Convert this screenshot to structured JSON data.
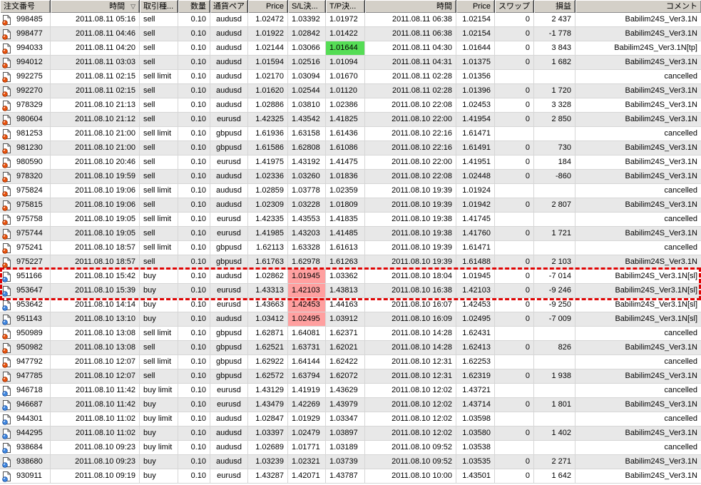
{
  "colors": {
    "header_bg": "#d4d0c8",
    "row_alt": "#e8e8e8",
    "grid": "#d6d6d6",
    "tp_highlight": "#55dd55",
    "sl_highlight": "#ffa0a0",
    "selection": "#e00505",
    "sell_ball": "#e8520e",
    "sell_ball_stroke": "#9a3000",
    "buy_ball": "#3f87e0",
    "buy_ball_stroke": "#1c4f9c"
  },
  "table": {
    "sort_icon": "▽",
    "columns": [
      {
        "id": "order",
        "label": "注文番号",
        "align": "left"
      },
      {
        "id": "open_time",
        "label": "時間",
        "align": "right"
      },
      {
        "id": "type",
        "label": "取引種...",
        "align": "left"
      },
      {
        "id": "volume",
        "label": "数量",
        "align": "right"
      },
      {
        "id": "pair",
        "label": "通貨ペア",
        "align": "center"
      },
      {
        "id": "open_price",
        "label": "Price",
        "align": "right"
      },
      {
        "id": "sl",
        "label": "S/L決...",
        "align": "left"
      },
      {
        "id": "tp",
        "label": "T/P決...",
        "align": "left"
      },
      {
        "id": "close_time",
        "label": "時間",
        "align": "right"
      },
      {
        "id": "close_price",
        "label": "Price",
        "align": "right"
      },
      {
        "id": "swap",
        "label": "スワップ",
        "align": "right"
      },
      {
        "id": "profit",
        "label": "損益",
        "align": "right"
      },
      {
        "id": "comment",
        "label": "コメント",
        "align": "right"
      }
    ],
    "rows": [
      {
        "order": "998485",
        "dir": "sell",
        "open_time": "2011.08.11 05:16",
        "type": "sell",
        "volume": "0.10",
        "pair": "audusd",
        "open_price": "1.02472",
        "sl": "1.03392",
        "tp": "1.01972",
        "close_time": "2011.08.11 06:38",
        "close_price": "1.02154",
        "swap": "0",
        "profit": "2 437",
        "comment": "Babilim24S_Ver3.1N"
      },
      {
        "order": "998477",
        "dir": "sell",
        "open_time": "2011.08.11 04:46",
        "type": "sell",
        "volume": "0.10",
        "pair": "audusd",
        "open_price": "1.01922",
        "sl": "1.02842",
        "tp": "1.01422",
        "close_time": "2011.08.11 06:38",
        "close_price": "1.02154",
        "swap": "0",
        "profit": "-1 778",
        "comment": "Babilim24S_Ver3.1N"
      },
      {
        "order": "994033",
        "dir": "sell",
        "open_time": "2011.08.11 04:20",
        "type": "sell",
        "volume": "0.10",
        "pair": "audusd",
        "open_price": "1.02144",
        "sl": "1.03066",
        "tp": "1.01644",
        "tp_hl": true,
        "close_time": "2011.08.11 04:30",
        "close_price": "1.01644",
        "swap": "0",
        "profit": "3 843",
        "comment": "Babilim24S_Ver3.1N[tp]"
      },
      {
        "order": "994012",
        "dir": "sell",
        "open_time": "2011.08.11 03:03",
        "type": "sell",
        "volume": "0.10",
        "pair": "audusd",
        "open_price": "1.01594",
        "sl": "1.02516",
        "tp": "1.01094",
        "close_time": "2011.08.11 04:31",
        "close_price": "1.01375",
        "swap": "0",
        "profit": "1 682",
        "comment": "Babilim24S_Ver3.1N"
      },
      {
        "order": "992275",
        "dir": "sell",
        "open_time": "2011.08.11 02:15",
        "type": "sell limit",
        "volume": "0.10",
        "pair": "audusd",
        "open_price": "1.02170",
        "sl": "1.03094",
        "tp": "1.01670",
        "close_time": "2011.08.11 02:28",
        "close_price": "1.01356",
        "swap": "",
        "profit": "",
        "comment": "cancelled"
      },
      {
        "order": "992270",
        "dir": "sell",
        "open_time": "2011.08.11 02:15",
        "type": "sell",
        "volume": "0.10",
        "pair": "audusd",
        "open_price": "1.01620",
        "sl": "1.02544",
        "tp": "1.01120",
        "close_time": "2011.08.11 02:28",
        "close_price": "1.01396",
        "swap": "0",
        "profit": "1 720",
        "comment": "Babilim24S_Ver3.1N"
      },
      {
        "order": "978329",
        "dir": "sell",
        "open_time": "2011.08.10 21:13",
        "type": "sell",
        "volume": "0.10",
        "pair": "audusd",
        "open_price": "1.02886",
        "sl": "1.03810",
        "tp": "1.02386",
        "close_time": "2011.08.10 22:08",
        "close_price": "1.02453",
        "swap": "0",
        "profit": "3 328",
        "comment": "Babilim24S_Ver3.1N"
      },
      {
        "order": "980604",
        "dir": "sell",
        "open_time": "2011.08.10 21:12",
        "type": "sell",
        "volume": "0.10",
        "pair": "eurusd",
        "open_price": "1.42325",
        "sl": "1.43542",
        "tp": "1.41825",
        "close_time": "2011.08.10 22:00",
        "close_price": "1.41954",
        "swap": "0",
        "profit": "2 850",
        "comment": "Babilim24S_Ver3.1N"
      },
      {
        "order": "981253",
        "dir": "sell",
        "open_time": "2011.08.10 21:00",
        "type": "sell limit",
        "volume": "0.10",
        "pair": "gbpusd",
        "open_price": "1.61936",
        "sl": "1.63158",
        "tp": "1.61436",
        "close_time": "2011.08.10 22:16",
        "close_price": "1.61471",
        "swap": "",
        "profit": "",
        "comment": "cancelled"
      },
      {
        "order": "981230",
        "dir": "sell",
        "open_time": "2011.08.10 21:00",
        "type": "sell",
        "volume": "0.10",
        "pair": "gbpusd",
        "open_price": "1.61586",
        "sl": "1.62808",
        "tp": "1.61086",
        "close_time": "2011.08.10 22:16",
        "close_price": "1.61491",
        "swap": "0",
        "profit": "730",
        "comment": "Babilim24S_Ver3.1N"
      },
      {
        "order": "980590",
        "dir": "sell",
        "open_time": "2011.08.10 20:46",
        "type": "sell",
        "volume": "0.10",
        "pair": "eurusd",
        "open_price": "1.41975",
        "sl": "1.43192",
        "tp": "1.41475",
        "close_time": "2011.08.10 22:00",
        "close_price": "1.41951",
        "swap": "0",
        "profit": "184",
        "comment": "Babilim24S_Ver3.1N"
      },
      {
        "order": "978320",
        "dir": "sell",
        "open_time": "2011.08.10 19:59",
        "type": "sell",
        "volume": "0.10",
        "pair": "audusd",
        "open_price": "1.02336",
        "sl": "1.03260",
        "tp": "1.01836",
        "close_time": "2011.08.10 22:08",
        "close_price": "1.02448",
        "swap": "0",
        "profit": "-860",
        "comment": "Babilim24S_Ver3.1N"
      },
      {
        "order": "975824",
        "dir": "sell",
        "open_time": "2011.08.10 19:06",
        "type": "sell limit",
        "volume": "0.10",
        "pair": "audusd",
        "open_price": "1.02859",
        "sl": "1.03778",
        "tp": "1.02359",
        "close_time": "2011.08.10 19:39",
        "close_price": "1.01924",
        "swap": "",
        "profit": "",
        "comment": "cancelled"
      },
      {
        "order": "975815",
        "dir": "sell",
        "open_time": "2011.08.10 19:06",
        "type": "sell",
        "volume": "0.10",
        "pair": "audusd",
        "open_price": "1.02309",
        "sl": "1.03228",
        "tp": "1.01809",
        "close_time": "2011.08.10 19:39",
        "close_price": "1.01942",
        "swap": "0",
        "profit": "2 807",
        "comment": "Babilim24S_Ver3.1N"
      },
      {
        "order": "975758",
        "dir": "sell",
        "open_time": "2011.08.10 19:05",
        "type": "sell limit",
        "volume": "0.10",
        "pair": "eurusd",
        "open_price": "1.42335",
        "sl": "1.43553",
        "tp": "1.41835",
        "close_time": "2011.08.10 19:38",
        "close_price": "1.41745",
        "swap": "",
        "profit": "",
        "comment": "cancelled"
      },
      {
        "order": "975744",
        "dir": "sell",
        "open_time": "2011.08.10 19:05",
        "type": "sell",
        "volume": "0.10",
        "pair": "eurusd",
        "open_price": "1.41985",
        "sl": "1.43203",
        "tp": "1.41485",
        "close_time": "2011.08.10 19:38",
        "close_price": "1.41760",
        "swap": "0",
        "profit": "1 721",
        "comment": "Babilim24S_Ver3.1N"
      },
      {
        "order": "975241",
        "dir": "sell",
        "open_time": "2011.08.10 18:57",
        "type": "sell limit",
        "volume": "0.10",
        "pair": "gbpusd",
        "open_price": "1.62113",
        "sl": "1.63328",
        "tp": "1.61613",
        "close_time": "2011.08.10 19:39",
        "close_price": "1.61471",
        "swap": "",
        "profit": "",
        "comment": "cancelled"
      },
      {
        "order": "975227",
        "dir": "sell",
        "open_time": "2011.08.10 18:57",
        "type": "sell",
        "volume": "0.10",
        "pair": "gbpusd",
        "open_price": "1.61763",
        "sl": "1.62978",
        "tp": "1.61263",
        "close_time": "2011.08.10 19:39",
        "close_price": "1.61488",
        "swap": "0",
        "profit": "2 103",
        "comment": "Babilim24S_Ver3.1N"
      },
      {
        "order": "951166",
        "dir": "buy",
        "selected": true,
        "open_time": "2011.08.10 15:42",
        "type": "buy",
        "volume": "0.10",
        "pair": "audusd",
        "open_price": "1.02862",
        "sl": "1.01945",
        "sl_hl": true,
        "tp": "1.03362",
        "close_time": "2011.08.10 18:04",
        "close_price": "1.01945",
        "swap": "0",
        "profit": "-7 014",
        "comment": "Babilim24S_Ver3.1N[sl]"
      },
      {
        "order": "953647",
        "dir": "buy",
        "selected": true,
        "open_time": "2011.08.10 15:39",
        "type": "buy",
        "volume": "0.10",
        "pair": "eurusd",
        "open_price": "1.43313",
        "sl": "1.42103",
        "sl_hl": true,
        "tp": "1.43813",
        "close_time": "2011.08.10 16:38",
        "close_price": "1.42103",
        "swap": "0",
        "profit": "-9 246",
        "comment": "Babilim24S_Ver3.1N[sl]"
      },
      {
        "order": "953642",
        "dir": "buy",
        "open_time": "2011.08.10 14:14",
        "type": "buy",
        "volume": "0.10",
        "pair": "eurusd",
        "open_price": "1.43663",
        "sl": "1.42453",
        "sl_hl": true,
        "tp": "1.44163",
        "close_time": "2011.08.10 16:07",
        "close_price": "1.42453",
        "swap": "0",
        "profit": "-9 250",
        "comment": "Babilim24S_Ver3.1N[sl]"
      },
      {
        "order": "951143",
        "dir": "buy",
        "open_time": "2011.08.10 13:10",
        "type": "buy",
        "volume": "0.10",
        "pair": "audusd",
        "open_price": "1.03412",
        "sl": "1.02495",
        "sl_hl": true,
        "tp": "1.03912",
        "close_time": "2011.08.10 16:09",
        "close_price": "1.02495",
        "swap": "0",
        "profit": "-7 009",
        "comment": "Babilim24S_Ver3.1N[sl]"
      },
      {
        "order": "950989",
        "dir": "sell",
        "open_time": "2011.08.10 13:08",
        "type": "sell limit",
        "volume": "0.10",
        "pair": "gbpusd",
        "open_price": "1.62871",
        "sl": "1.64081",
        "tp": "1.62371",
        "close_time": "2011.08.10 14:28",
        "close_price": "1.62431",
        "swap": "",
        "profit": "",
        "comment": "cancelled"
      },
      {
        "order": "950982",
        "dir": "sell",
        "open_time": "2011.08.10 13:08",
        "type": "sell",
        "volume": "0.10",
        "pair": "gbpusd",
        "open_price": "1.62521",
        "sl": "1.63731",
        "tp": "1.62021",
        "close_time": "2011.08.10 14:28",
        "close_price": "1.62413",
        "swap": "0",
        "profit": "826",
        "comment": "Babilim24S_Ver3.1N"
      },
      {
        "order": "947792",
        "dir": "sell",
        "open_time": "2011.08.10 12:07",
        "type": "sell limit",
        "volume": "0.10",
        "pair": "gbpusd",
        "open_price": "1.62922",
        "sl": "1.64144",
        "tp": "1.62422",
        "close_time": "2011.08.10 12:31",
        "close_price": "1.62253",
        "swap": "",
        "profit": "",
        "comment": "cancelled"
      },
      {
        "order": "947785",
        "dir": "sell",
        "open_time": "2011.08.10 12:07",
        "type": "sell",
        "volume": "0.10",
        "pair": "gbpusd",
        "open_price": "1.62572",
        "sl": "1.63794",
        "tp": "1.62072",
        "close_time": "2011.08.10 12:31",
        "close_price": "1.62319",
        "swap": "0",
        "profit": "1 938",
        "comment": "Babilim24S_Ver3.1N"
      },
      {
        "order": "946718",
        "dir": "buy",
        "open_time": "2011.08.10 11:42",
        "type": "buy limit",
        "volume": "0.10",
        "pair": "eurusd",
        "open_price": "1.43129",
        "sl": "1.41919",
        "tp": "1.43629",
        "close_time": "2011.08.10 12:02",
        "close_price": "1.43721",
        "swap": "",
        "profit": "",
        "comment": "cancelled"
      },
      {
        "order": "946687",
        "dir": "buy",
        "open_time": "2011.08.10 11:42",
        "type": "buy",
        "volume": "0.10",
        "pair": "eurusd",
        "open_price": "1.43479",
        "sl": "1.42269",
        "tp": "1.43979",
        "close_time": "2011.08.10 12:02",
        "close_price": "1.43714",
        "swap": "0",
        "profit": "1 801",
        "comment": "Babilim24S_Ver3.1N"
      },
      {
        "order": "944301",
        "dir": "buy",
        "open_time": "2011.08.10 11:02",
        "type": "buy limit",
        "volume": "0.10",
        "pair": "audusd",
        "open_price": "1.02847",
        "sl": "1.01929",
        "tp": "1.03347",
        "close_time": "2011.08.10 12:02",
        "close_price": "1.03598",
        "swap": "",
        "profit": "",
        "comment": "cancelled"
      },
      {
        "order": "944295",
        "dir": "buy",
        "open_time": "2011.08.10 11:02",
        "type": "buy",
        "volume": "0.10",
        "pair": "audusd",
        "open_price": "1.03397",
        "sl": "1.02479",
        "tp": "1.03897",
        "close_time": "2011.08.10 12:02",
        "close_price": "1.03580",
        "swap": "0",
        "profit": "1 402",
        "comment": "Babilim24S_Ver3.1N"
      },
      {
        "order": "938684",
        "dir": "buy",
        "open_time": "2011.08.10 09:23",
        "type": "buy limit",
        "volume": "0.10",
        "pair": "audusd",
        "open_price": "1.02689",
        "sl": "1.01771",
        "tp": "1.03189",
        "close_time": "2011.08.10 09:52",
        "close_price": "1.03538",
        "swap": "",
        "profit": "",
        "comment": "cancelled"
      },
      {
        "order": "938680",
        "dir": "buy",
        "open_time": "2011.08.10 09:23",
        "type": "buy",
        "volume": "0.10",
        "pair": "audusd",
        "open_price": "1.03239",
        "sl": "1.02321",
        "tp": "1.03739",
        "close_time": "2011.08.10 09:52",
        "close_price": "1.03535",
        "swap": "0",
        "profit": "2 271",
        "comment": "Babilim24S_Ver3.1N"
      },
      {
        "order": "930911",
        "dir": "buy",
        "open_time": "2011.08.10 09:19",
        "type": "buy",
        "volume": "0.10",
        "pair": "eurusd",
        "open_price": "1.43287",
        "sl": "1.42071",
        "tp": "1.43787",
        "close_time": "2011.08.10 10:00",
        "close_price": "1.43501",
        "swap": "0",
        "profit": "1 642",
        "comment": "Babilim24S_Ver3.1N"
      }
    ]
  }
}
